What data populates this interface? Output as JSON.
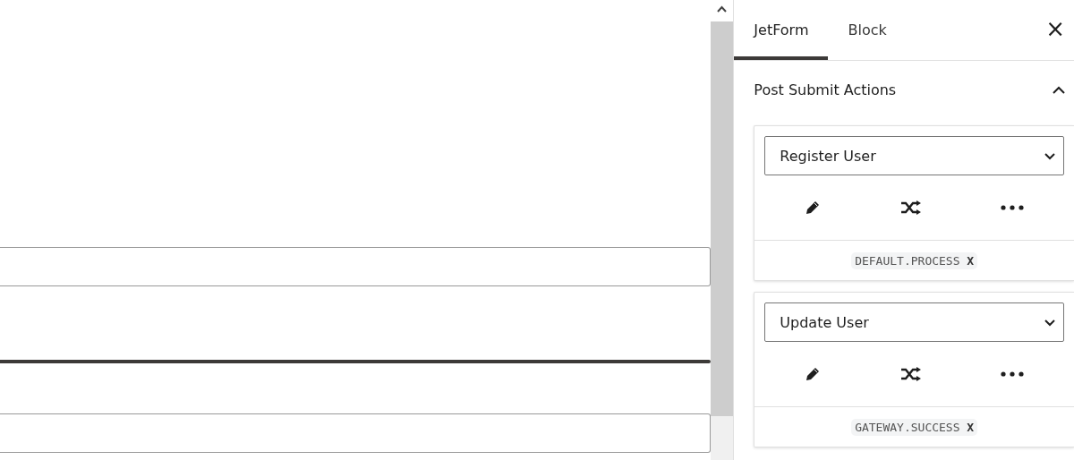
{
  "tabs": [
    {
      "label": "JetForm",
      "selected": true
    },
    {
      "label": "Block",
      "selected": false
    }
  ],
  "close": "×",
  "panel": {
    "title": "Post Submit Actions",
    "expanded": true
  },
  "actions": [
    {
      "type": "Register User",
      "event": "DEFAULT.PROCESS",
      "remove": "X"
    },
    {
      "type": "Update User",
      "event": "GATEWAY.SUCCESS",
      "remove": "X"
    }
  ]
}
